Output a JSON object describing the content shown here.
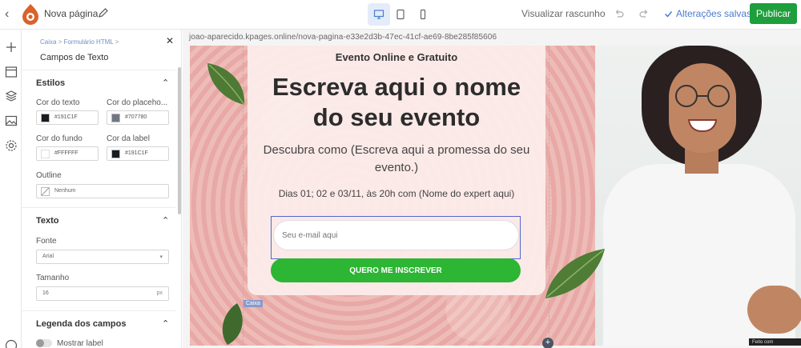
{
  "topbar": {
    "page_name": "Nova página",
    "preview_label": "Visualizar rascunho",
    "saved_label": "Alterações salvas",
    "publish_label": "Publicar"
  },
  "panel": {
    "breadcrumb": [
      "Caixa",
      "Formulário HTML"
    ],
    "title": "Campos de Texto",
    "styles": {
      "heading": "Estilos",
      "text_color_label": "Cor do texto",
      "text_color": "#191C1F",
      "placeholder_label": "Cor do placeho...",
      "placeholder_color": "#707780",
      "bg_label": "Cor do fundo",
      "bg_color": "#FFFFFF",
      "label_color_label": "Cor da label",
      "label_color": "#191C1F",
      "outline_label": "Outline",
      "outline_value": "Nenhum"
    },
    "text": {
      "heading": "Texto",
      "font_label": "Fonte",
      "font_value": "Arial",
      "size_label": "Tamanho",
      "size_value": "16",
      "size_unit": "px"
    },
    "legend": {
      "heading": "Legenda dos campos",
      "show_label": "Mostrar label",
      "show_label_on": false
    }
  },
  "canvas": {
    "url": "joao-aparecido.kpages.online/nova-pagina-e33e2d3b-47ec-41cf-ae69-8be285f85606",
    "kicker": "Evento Online e Gratuito",
    "headline": "Escreva aqui o nome do seu evento",
    "promise": "Descubra como (Escreva aqui a promessa do seu evento.)",
    "date": "Dias 01; 02 e 03/11, às 20h com (Nome do expert aqui)",
    "email_placeholder": "Seu e-mail aqui",
    "cta_label": "QUERO ME INSCREVER",
    "selection_tag": "Caixa",
    "powered_by": "Feito com"
  },
  "colors": {
    "publish": "#1e9e3c",
    "accent": "#4a7bd0",
    "cta": "#2db534"
  }
}
